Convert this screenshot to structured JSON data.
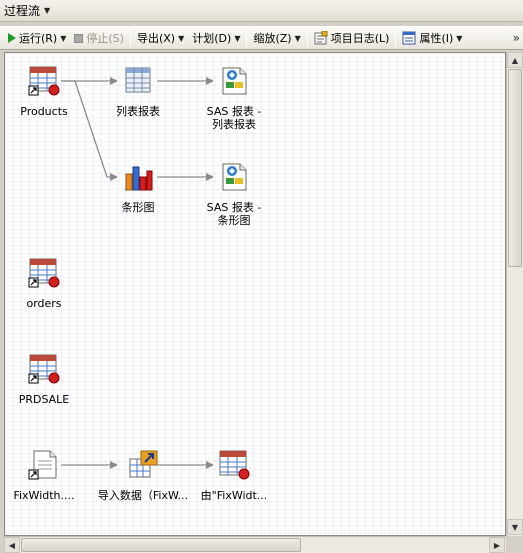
{
  "window": {
    "title": "过程流"
  },
  "toolbar": {
    "run": "运行(R)",
    "stop": "停止(S)",
    "export": "导出(X)",
    "schedule": "计划(D)",
    "zoom": "缩放(Z)",
    "project_log": "项目日志(L)",
    "properties": "属性(I)"
  },
  "nodes": {
    "products": {
      "label": "Products",
      "icon": "data-table-icon"
    },
    "list_report": {
      "label": "列表报表",
      "icon": "list-table-icon"
    },
    "sas_list_report": {
      "line1": "SAS 报表 -",
      "line2": "列表报表",
      "icon": "sas-report-icon"
    },
    "bar_chart": {
      "label": "条形图",
      "icon": "bar-chart-icon"
    },
    "sas_bar_report": {
      "line1": "SAS 报表 -",
      "line2": "条形图",
      "icon": "sas-report-icon"
    },
    "orders": {
      "label": "orders",
      "icon": "data-table-icon"
    },
    "prdsale": {
      "label": "PRDSALE",
      "icon": "data-table-icon"
    },
    "fixwidth": {
      "label": "FixWidth....",
      "icon": "text-file-icon"
    },
    "import_data": {
      "label": "导入数据（FixW...",
      "icon": "import-data-icon"
    },
    "from_fixwidth": {
      "label": "由\"FixWidt...",
      "icon": "data-table-icon"
    }
  },
  "colors": {
    "run_icon": "#1f9b2a",
    "table_header": "#b84a3a",
    "table_body": "#4a78c8",
    "badge": "#d02020",
    "link_line": "#8c8c8c"
  }
}
